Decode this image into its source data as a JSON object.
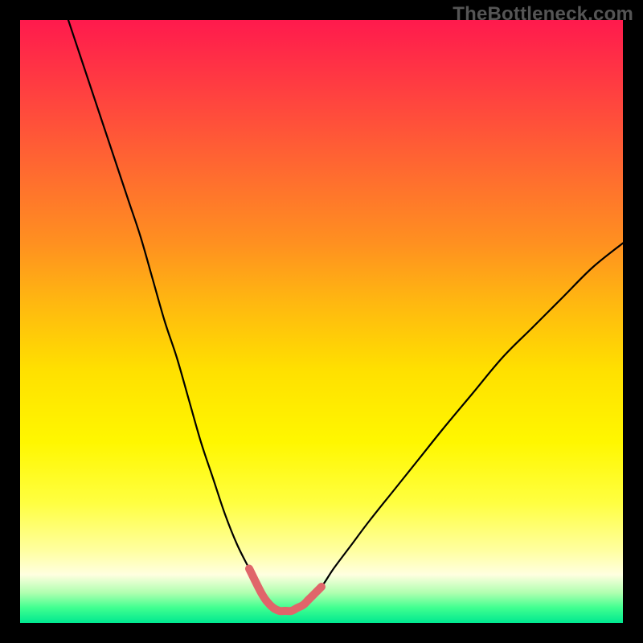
{
  "watermark": "TheBottleneck.com",
  "colors": {
    "background": "#000000",
    "curve_main": "#000000",
    "curve_highlight": "#e0656a"
  },
  "chart_data": {
    "type": "line",
    "title": "",
    "xlabel": "",
    "ylabel": "",
    "xlim": [
      0,
      100
    ],
    "ylim": [
      0,
      100
    ],
    "grid": false,
    "series": [
      {
        "name": "bottleneck-curve",
        "x": [
          8,
          10,
          12,
          14,
          16,
          18,
          20,
          22,
          24,
          26,
          28,
          30,
          32,
          34,
          36,
          38,
          40,
          41,
          42,
          43,
          44,
          45,
          46,
          47,
          48,
          50,
          52,
          55,
          58,
          62,
          66,
          70,
          75,
          80,
          85,
          90,
          95,
          100
        ],
        "values": [
          100,
          94,
          88,
          82,
          76,
          70,
          64,
          57,
          50,
          44,
          37,
          30,
          24,
          18,
          13,
          9,
          5,
          3.5,
          2.5,
          2,
          2,
          2,
          2.5,
          3,
          4,
          6,
          9,
          13,
          17,
          22,
          27,
          32,
          38,
          44,
          49,
          54,
          59,
          63
        ]
      }
    ],
    "annotations": [
      {
        "name": "optimal-range-highlight",
        "x_start": 38,
        "x_end": 50
      }
    ]
  }
}
